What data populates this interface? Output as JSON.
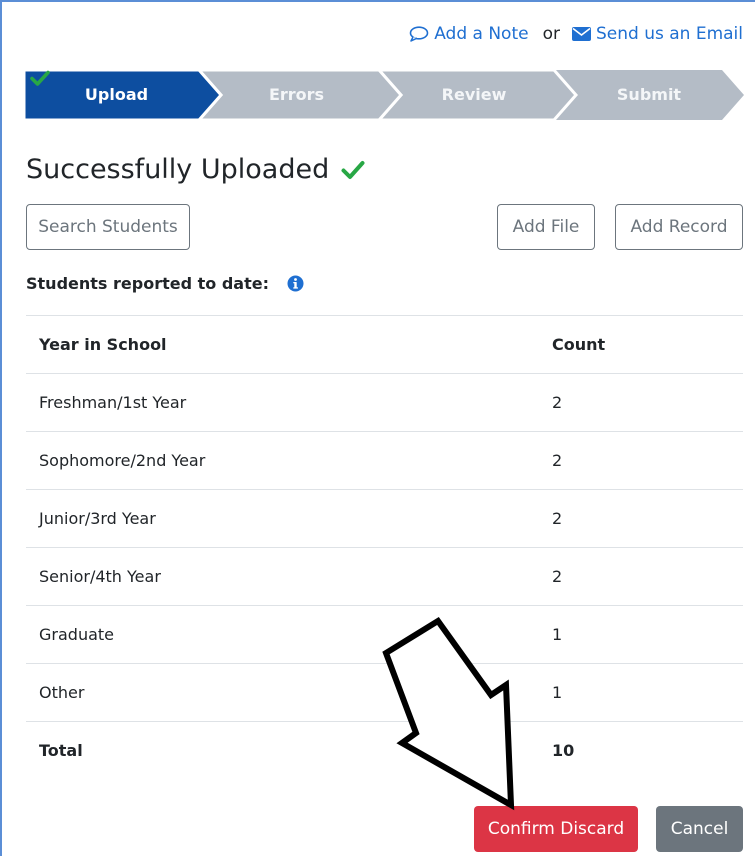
{
  "links": {
    "add_note": "Add a Note",
    "or": "or",
    "send_email": "Send us an Email"
  },
  "steps": [
    {
      "label": "Upload",
      "state": "complete"
    },
    {
      "label": "Errors",
      "state": "inactive"
    },
    {
      "label": "Review",
      "state": "inactive"
    },
    {
      "label": "Submit",
      "state": "inactive"
    }
  ],
  "heading": "Successfully Uploaded",
  "toolbar": {
    "search_students": "Search Students",
    "add_file": "Add File",
    "add_record": "Add Record"
  },
  "reported_label": "Students reported to date:",
  "table": {
    "headers": [
      "Year in School",
      "Count"
    ],
    "rows": [
      [
        "Freshman/1st Year",
        "2"
      ],
      [
        "Sophomore/2nd Year",
        "2"
      ],
      [
        "Junior/3rd Year",
        "2"
      ],
      [
        "Senior/4th Year",
        "2"
      ],
      [
        "Graduate",
        "1"
      ],
      [
        "Other",
        "1"
      ]
    ],
    "total": [
      "Total",
      "10"
    ]
  },
  "actions": {
    "confirm_discard": "Confirm Discard",
    "cancel": "Cancel"
  },
  "colors": {
    "step_active": "#0d4ea0",
    "step_inactive": "#b4bcc6",
    "success": "#28a745",
    "danger": "#dc3545",
    "secondary": "#6c757d",
    "link": "#1f6fd1"
  },
  "icons": {
    "note": "speech-bubble-icon",
    "email": "envelope-icon",
    "check": "checkmark-icon",
    "info": "info-circle-icon",
    "annotation": "down-arrow-annotation"
  }
}
